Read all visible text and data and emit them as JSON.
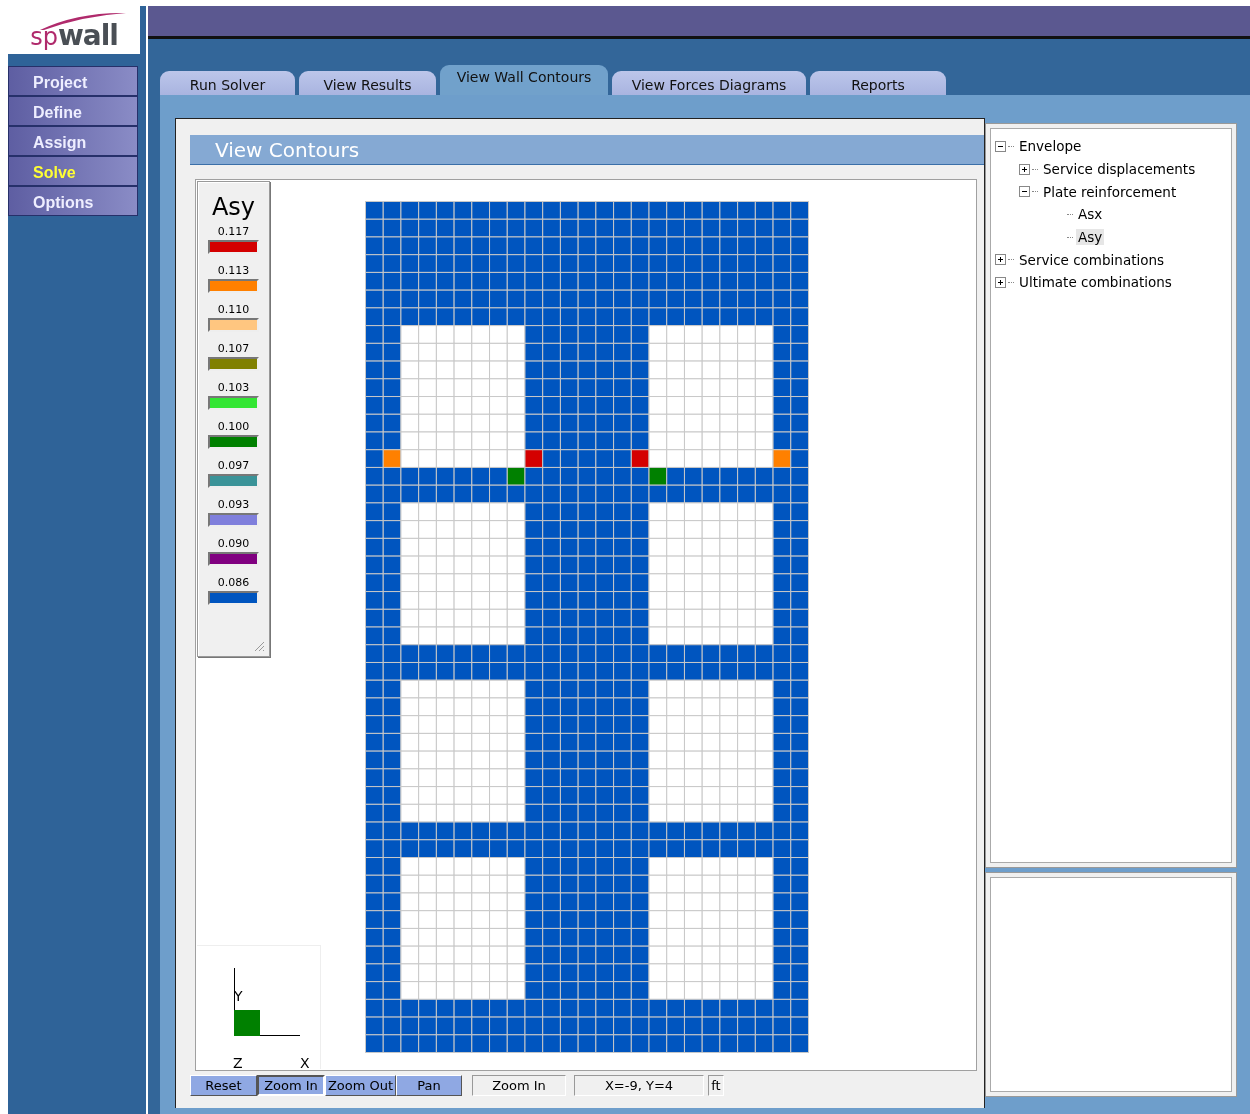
{
  "logo": {
    "prefix": "sp",
    "name": "wall"
  },
  "menu": [
    {
      "label": "Project",
      "selected": false
    },
    {
      "label": "Define",
      "selected": false
    },
    {
      "label": "Assign",
      "selected": false
    },
    {
      "label": "Solve",
      "selected": true
    },
    {
      "label": "Options",
      "selected": false
    }
  ],
  "tabs": [
    {
      "label": "Run Solver",
      "selected": false
    },
    {
      "label": "View Results",
      "selected": false
    },
    {
      "label": "View Wall Contours",
      "selected": true
    },
    {
      "label": "View Forces Diagrams",
      "selected": false
    },
    {
      "label": "Reports",
      "selected": false
    }
  ],
  "panel_title": "View Contours",
  "legend": {
    "title": "Asy",
    "items": [
      {
        "value": "0.117",
        "color": "#d40000"
      },
      {
        "value": "0.113",
        "color": "#ff8000"
      },
      {
        "value": "0.110",
        "color": "#ffc680"
      },
      {
        "value": "0.107",
        "color": "#808000"
      },
      {
        "value": "0.103",
        "color": "#33e633"
      },
      {
        "value": "0.100",
        "color": "#008000"
      },
      {
        "value": "0.097",
        "color": "#3a9398"
      },
      {
        "value": "0.093",
        "color": "#7f7fdc"
      },
      {
        "value": "0.090",
        "color": "#800080"
      },
      {
        "value": "0.086",
        "color": "#0055bf"
      }
    ]
  },
  "axes": {
    "y_label": "Y",
    "z_label": "Z",
    "x_label": "X"
  },
  "toolbar": {
    "buttons": [
      {
        "label": "Reset",
        "pressed": false
      },
      {
        "label": "Zoom In",
        "pressed": true
      },
      {
        "label": "Zoom Out",
        "pressed": false
      },
      {
        "label": "Pan",
        "pressed": false
      }
    ],
    "mode": "Zoom In",
    "coordinates": "X=-9, Y=4",
    "unit": "ft"
  },
  "tree": [
    {
      "label": "Envelope",
      "kind": "group",
      "expanded": true,
      "selected": false,
      "children": [
        {
          "label": "Service displacements",
          "kind": "group",
          "expanded": false,
          "selected": false
        },
        {
          "label": "Plate reinforcement",
          "kind": "group",
          "expanded": true,
          "selected": false,
          "children": [
            {
              "label": "Asx",
              "kind": "leaf",
              "selected": false
            },
            {
              "label": "Asy",
              "kind": "leaf",
              "selected": true
            }
          ]
        }
      ]
    },
    {
      "label": "Service combinations",
      "kind": "group",
      "expanded": false,
      "selected": false
    },
    {
      "label": "Ultimate combinations",
      "kind": "group",
      "expanded": false,
      "selected": false
    }
  ]
}
